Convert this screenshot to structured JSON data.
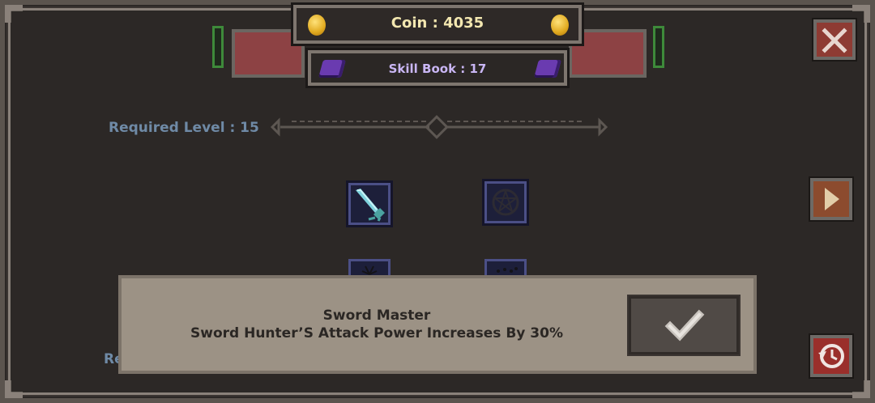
{
  "header": {
    "coin_text": "Coin : 4035",
    "skill_book_text": "Skill Book : 17"
  },
  "skill_panel": {
    "required_level_text": "Required Level : 15",
    "required_level_2_partial": "Re"
  },
  "popup": {
    "skill_name": "Sword Master",
    "description": "Sword Hunter’S Attack Power Increases By 30%"
  },
  "icons": {
    "coin": "coin-icon",
    "skill_book": "skill-book-icon",
    "close": "close-x-icon",
    "next": "triangle-right-icon",
    "reset": "history-reset-icon",
    "confirm": "checkmark-icon",
    "skill_sword": "sword-skill-icon",
    "skill_pentagram": "pentagram-skill-icon"
  },
  "colors": {
    "coin_text": "#f3e7b0",
    "skill_book_text": "#c9b6f4",
    "required_level": "#6f8aa6",
    "close_button": "#8e3b33",
    "banner_red": "#8d4244"
  }
}
